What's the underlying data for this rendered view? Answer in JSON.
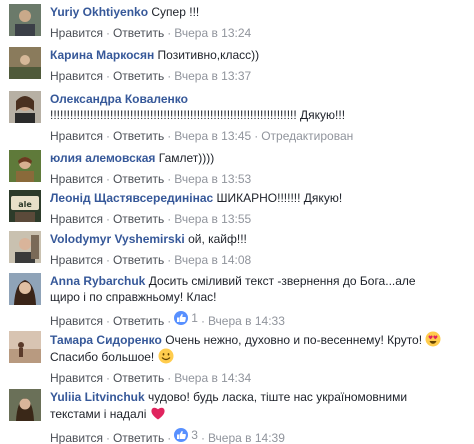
{
  "colors": {
    "author": "#365899",
    "meta": "#90949c",
    "link": "#4b4f56",
    "like_blue": "#5890ff"
  },
  "actions": {
    "like": "Нравится",
    "reply": "Ответить",
    "separator": "·"
  },
  "comments": [
    {
      "author": "Yuriy Okhtiyenko",
      "text": "Супер !!!",
      "time": "Вчера в 13:24"
    },
    {
      "author": "Карина Маркосян",
      "text": "Позитивно,класс))",
      "time": "Вчера в 13:37"
    },
    {
      "author": "Олександра Коваленко",
      "text": "!!!!!!!!!!!!!!!!!!!!!!!!!!!!!!!!!!!!!!!!!!!!!!!!!!!!!!!!!!!!!!!!!!!!!!!!!! Дякую!!!",
      "time": "Вчера в 13:45",
      "edited": "Отредактирован"
    },
    {
      "author": "юлия алемовская",
      "text": "Гамлет))))",
      "time": "Вчера в 13:53"
    },
    {
      "author": "Леонід Щастявсерединінас",
      "text": "ШИКАРНО!!!!!!! Дякую!",
      "time": "Вчера в 13:55"
    },
    {
      "author": "Volodymyr Vyshemirski",
      "text": "ой, кайф!!!",
      "time": "Вчера в 14:08"
    },
    {
      "author": "Anna Rybarchuk",
      "text": "Досить сміливий текст -звернення до Бога...але щиро і по справжньому! Клас!",
      "time": "Вчера в 14:33",
      "likes": "1"
    },
    {
      "author": "Тамара Сидоренко",
      "text": "Очень нежно, духовно и по-весеннему! Круто!",
      "text2": "Спасибо большое!",
      "time": "Вчера в 14:34",
      "emoji1": "heart-eyes-emoji",
      "emoji2": "smile-emoji"
    },
    {
      "author": "Yuliia Litvinchuk",
      "text": "чудово! будь ласка, тіште нас україномовними текстами і надалі",
      "time": "Вчера в 14:39",
      "likes": "3",
      "emoji1": "heart-emoji"
    }
  ]
}
